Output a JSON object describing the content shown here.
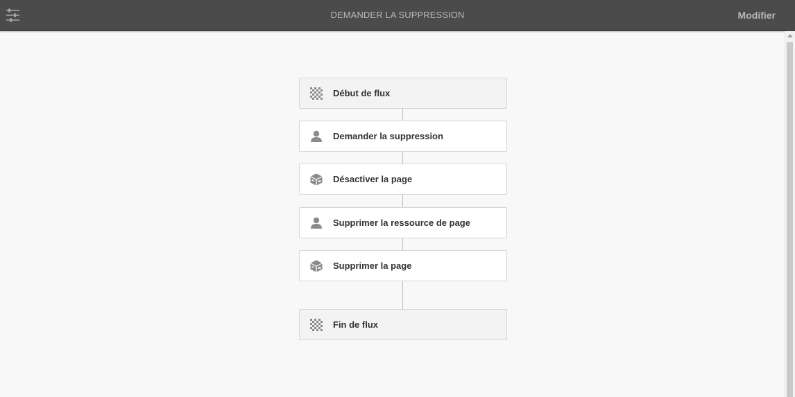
{
  "header": {
    "title": "DEMANDER LA SUPPRESSION",
    "modify_label": "Modifier",
    "sidebar_icon": "sliders-icon"
  },
  "workflow": {
    "steps": [
      {
        "label": "Début de flux",
        "icon": "checkered-flag-icon",
        "kind": "start"
      },
      {
        "label": "Demander la suppression",
        "icon": "user-icon",
        "kind": "participant"
      },
      {
        "label": "Désactiver la page",
        "icon": "process-box-icon",
        "kind": "process"
      },
      {
        "label": "Supprimer la ressource de page",
        "icon": "user-icon",
        "kind": "participant"
      },
      {
        "label": "Supprimer la page",
        "icon": "process-box-icon",
        "kind": "process"
      },
      {
        "label": "Fin de flux",
        "icon": "checkered-flag-icon",
        "kind": "end"
      }
    ]
  },
  "colors": {
    "topbar": "#4b4b4b",
    "background": "#f8f8f8",
    "icon_gray": "#8a8a8a"
  }
}
